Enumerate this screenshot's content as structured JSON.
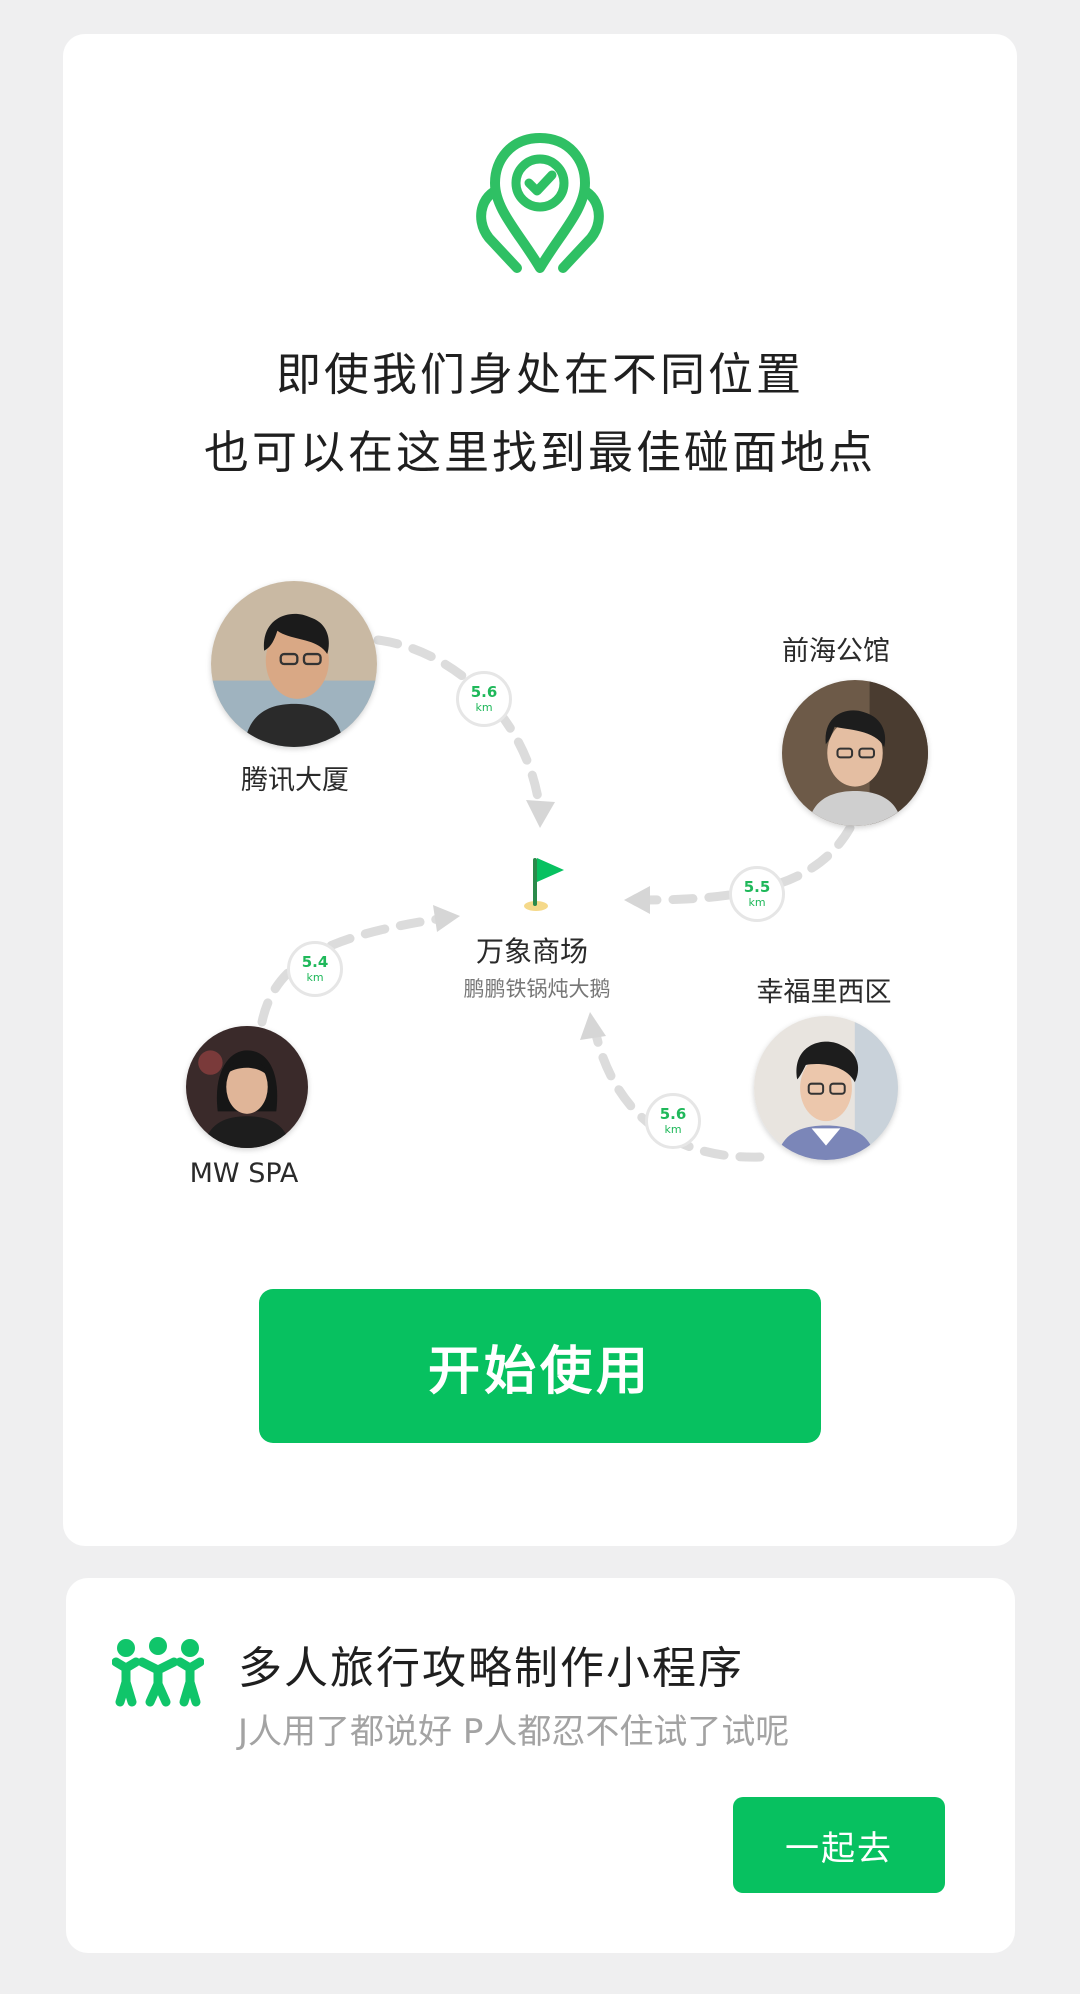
{
  "headline": {
    "line1": "即使我们身处在不同位置",
    "line2": "也可以在这里找到最佳碰面地点"
  },
  "participants": [
    {
      "place": "腾讯大厦",
      "distance": "5.6",
      "unit": "km"
    },
    {
      "place": "前海公馆",
      "distance": "5.5",
      "unit": "km"
    },
    {
      "place": "MW SPA",
      "distance": "5.4",
      "unit": "km"
    },
    {
      "place": "幸福里西区",
      "distance": "5.6",
      "unit": "km"
    }
  ],
  "destination": {
    "name": "万象商场",
    "subtitle": "鹏鹏铁锅炖大鹅"
  },
  "start_button": {
    "label": "开始使用"
  },
  "promo": {
    "title": "多人旅行攻略制作小程序",
    "subtitle": "J人用了都说好 P人都忍不住试了试呢",
    "button_label": "一起去"
  },
  "colors": {
    "accent": "#07c160",
    "background": "#efeff0",
    "card": "#ffffff"
  },
  "icons": [
    "location-check-icon",
    "flag-icon",
    "group-people-icon"
  ]
}
